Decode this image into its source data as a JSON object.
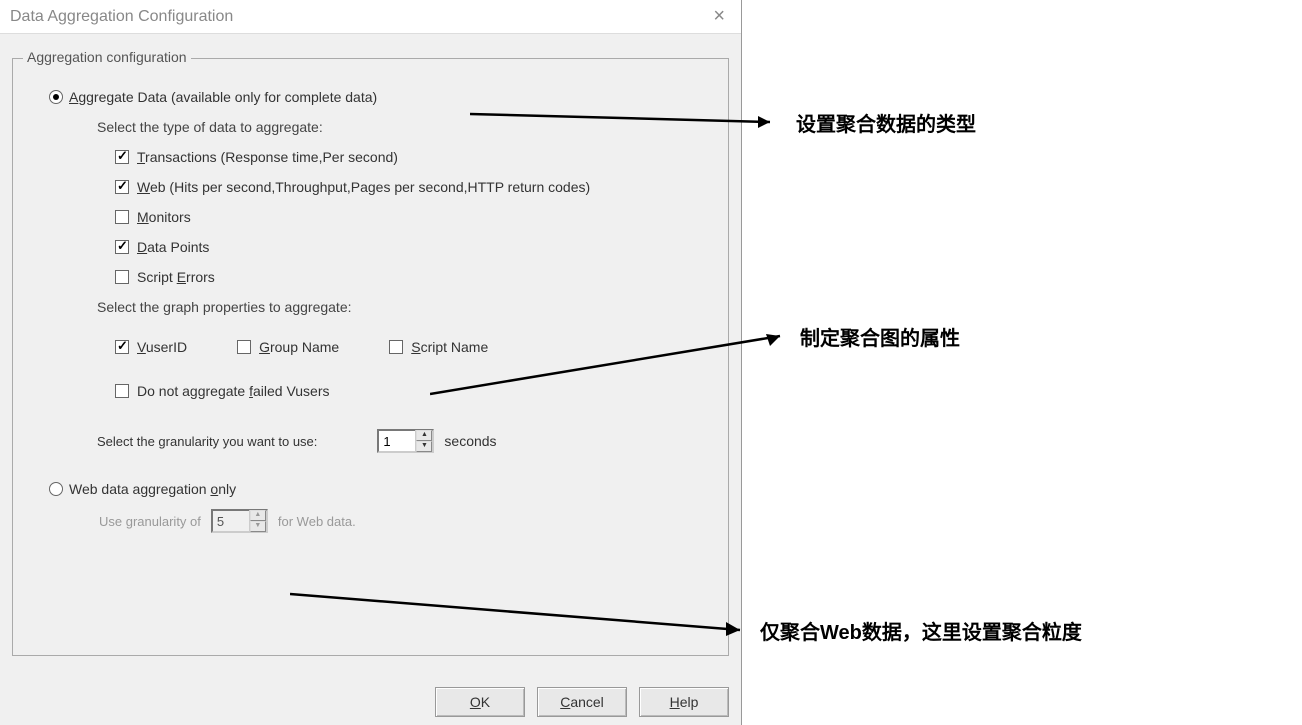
{
  "dialog": {
    "title": "Data Aggregation Configuration",
    "groupbox_label": "Aggregation configuration",
    "radio_aggregate": "Aggregate Data (available only for complete data)",
    "radio_webonly": "Web data aggregation only",
    "type_label": "Select the type of data to aggregate:",
    "types": {
      "transactions": "Transactions (Response time,Per second)",
      "web": "Web (Hits per second,Throughput,Pages per second,HTTP return codes)",
      "monitors": "Monitors",
      "datapoints": "Data Points",
      "scripterrors": "Script Errors"
    },
    "props_label": "Select the graph properties to aggregate:",
    "props": {
      "vuserid": "VuserID",
      "groupname": "Group Name",
      "scriptname": "Script Name",
      "failed": "Do not aggregate failed Vusers"
    },
    "granularity_label": "Select the granularity you want to use:",
    "granularity_value": "1",
    "seconds": "seconds",
    "webonly_prefix": "Use granularity of",
    "webonly_value": "5",
    "webonly_suffix": "for Web data.",
    "buttons": {
      "ok": "OK",
      "cancel": "Cancel",
      "help": "Help"
    }
  },
  "annotations": {
    "a1": "设置聚合数据的类型",
    "a2": "制定聚合图的属性",
    "a3": "仅聚合Web数据，这里设置聚合粒度"
  }
}
